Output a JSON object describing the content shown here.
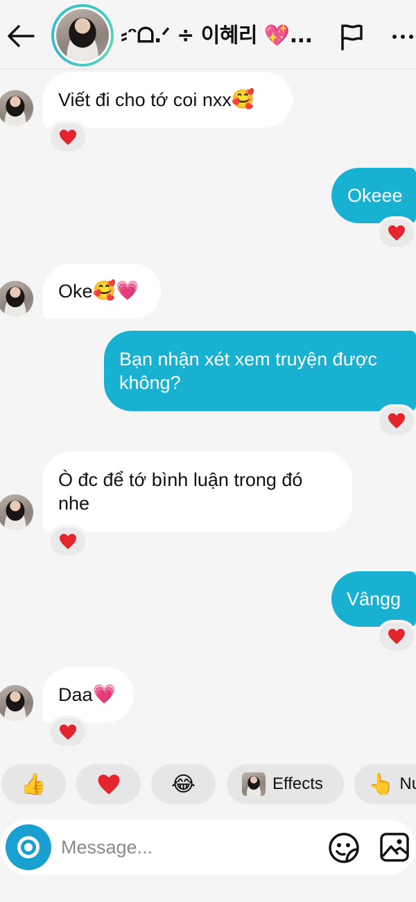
{
  "header": {
    "contact_name": "⸗ᵔᗝ.ᐟ ÷ 이혜리 💖...",
    "icons": {
      "back": "arrow-left-icon",
      "flag": "flag-icon",
      "more": "more-horizontal-icon"
    }
  },
  "messages": [
    {
      "direction": "in",
      "text": "Viết đi cho tớ coi nxx",
      "emoji": "🥰",
      "reaction": "❤️"
    },
    {
      "direction": "out",
      "text": "Okeee",
      "emoji": "",
      "reaction": "❤️"
    },
    {
      "direction": "in",
      "text": "Oke",
      "emoji": "🥰💗",
      "reaction": ""
    },
    {
      "direction": "out",
      "line1": "Bạn nhận xét xem truyện được",
      "line2": "không?",
      "reaction": "❤️"
    },
    {
      "direction": "in",
      "line1": "Ò đc để tớ bình luận trong đó",
      "line2": "nhe",
      "reaction": "❤️"
    },
    {
      "direction": "out",
      "text": "Vângg",
      "emoji": "",
      "reaction": "❤️"
    },
    {
      "direction": "in",
      "text": "Daa",
      "emoji": "💗",
      "reaction": "❤️"
    }
  ],
  "quick_reactions": {
    "thumbs_up": "👍",
    "heart": "❤️",
    "laugh": "😂",
    "effects_label": "Effects",
    "nudge_glyph": "👆",
    "nudge_label": "Nudge"
  },
  "composer": {
    "placeholder": "Message...",
    "icons": {
      "camera": "camera-icon",
      "sticker": "sticker-icon",
      "gallery": "gallery-icon"
    }
  },
  "colors": {
    "background": "#f5f5f5",
    "incoming_bubble": "#ffffff",
    "outgoing_bubble": "#18b1d2",
    "accent_camera": "#1a9fd1",
    "heart": "#e3262d"
  }
}
